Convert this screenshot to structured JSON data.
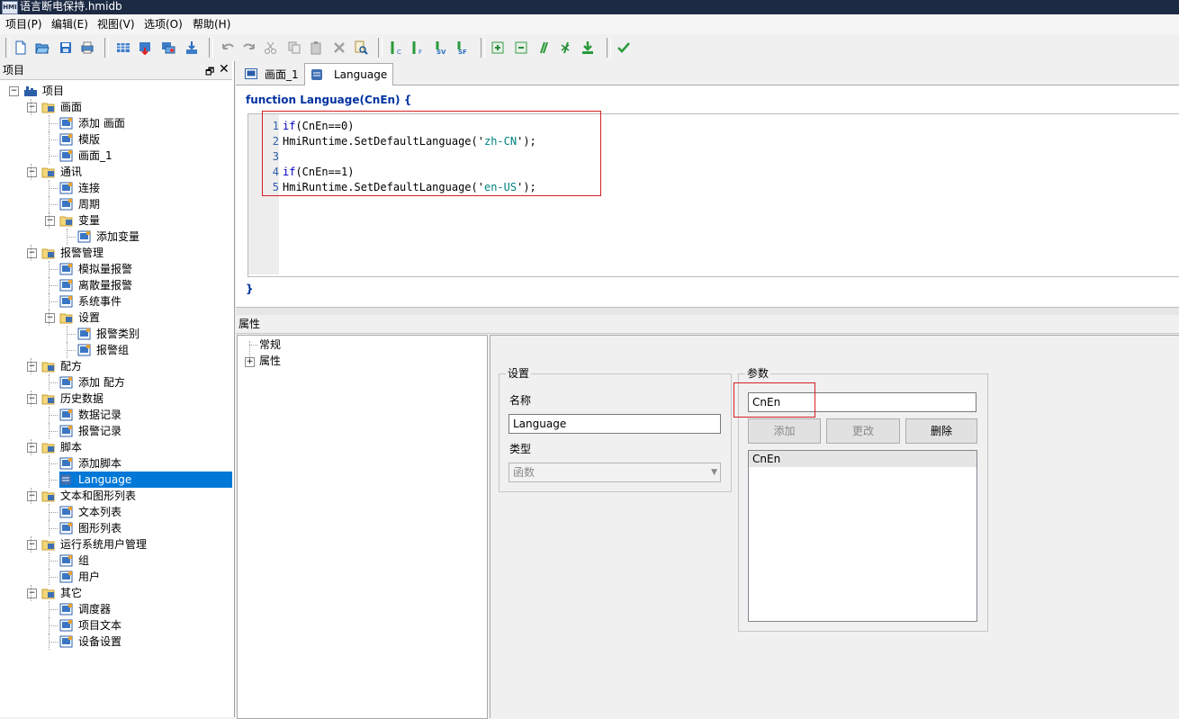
{
  "window": {
    "app_icon": "HMI",
    "title": "语言断电保持.hmidb"
  },
  "menu": [
    "项目(P)",
    "编辑(E)",
    "视图(V)",
    "选项(O)",
    "帮助(H)"
  ],
  "toolbar_icons": [
    "new-file-icon",
    "open-folder-icon",
    "save-icon",
    "print-icon",
    "grid-icon",
    "download-icon",
    "transfer-icon",
    "export-icon",
    "undo-icon",
    "redo-icon",
    "cut-icon",
    "copy-icon",
    "paste-icon",
    "delete-icon",
    "find-icon",
    "compile-c-icon",
    "compile-f-icon",
    "sv-icon",
    "sf-icon",
    "indent-icon",
    "outdent-icon",
    "comment-icon",
    "uncomment-icon",
    "insert-icon",
    "check-icon"
  ],
  "project_panel": {
    "title": "项目",
    "pin": "🗗",
    "close": "✕",
    "tree": [
      {
        "label": "项目",
        "level": 0,
        "icon": "project-icon"
      },
      {
        "label": "画面",
        "level": 1,
        "icon": "screens-folder-icon"
      },
      {
        "label": "添加 画面",
        "level": 2,
        "icon": "add-screen-icon"
      },
      {
        "label": "模版",
        "level": 2,
        "icon": "template-icon"
      },
      {
        "label": "画面_1",
        "level": 2,
        "icon": "screen-icon"
      },
      {
        "label": "通讯",
        "level": 1,
        "icon": "comm-folder-icon"
      },
      {
        "label": "连接",
        "level": 2,
        "icon": "connection-icon"
      },
      {
        "label": "周期",
        "level": 2,
        "icon": "cycle-icon"
      },
      {
        "label": "变量",
        "level": 2,
        "icon": "variables-folder-icon"
      },
      {
        "label": "添加变量",
        "level": 3,
        "icon": "add-variable-icon"
      },
      {
        "label": "报警管理",
        "level": 1,
        "icon": "alarm-folder-icon"
      },
      {
        "label": "模拟量报警",
        "level": 2,
        "icon": "analog-alarm-icon"
      },
      {
        "label": "离散量报警",
        "level": 2,
        "icon": "discrete-alarm-icon"
      },
      {
        "label": "系统事件",
        "level": 2,
        "icon": "system-event-icon"
      },
      {
        "label": "设置",
        "level": 2,
        "icon": "settings-folder-icon"
      },
      {
        "label": "报警类别",
        "level": 3,
        "icon": "alarm-class-icon"
      },
      {
        "label": "报警组",
        "level": 3,
        "icon": "alarm-group-icon"
      },
      {
        "label": "配方",
        "level": 1,
        "icon": "recipe-folder-icon"
      },
      {
        "label": "添加 配方",
        "level": 2,
        "icon": "add-recipe-icon"
      },
      {
        "label": "历史数据",
        "level": 1,
        "icon": "history-folder-icon"
      },
      {
        "label": "数据记录",
        "level": 2,
        "icon": "data-log-icon"
      },
      {
        "label": "报警记录",
        "level": 2,
        "icon": "alarm-log-icon"
      },
      {
        "label": "脚本",
        "level": 1,
        "icon": "scripts-folder-icon"
      },
      {
        "label": "添加脚本",
        "level": 2,
        "icon": "add-script-icon"
      },
      {
        "label": "Language",
        "level": 2,
        "icon": "script-icon",
        "selected": true
      },
      {
        "label": "文本和图形列表",
        "level": 1,
        "icon": "lists-folder-icon"
      },
      {
        "label": "文本列表",
        "level": 2,
        "icon": "text-list-icon"
      },
      {
        "label": "图形列表",
        "level": 2,
        "icon": "graphic-list-icon"
      },
      {
        "label": "运行系统用户管理",
        "level": 1,
        "icon": "user-admin-folder-icon"
      },
      {
        "label": "组",
        "level": 2,
        "icon": "group-icon"
      },
      {
        "label": "用户",
        "level": 2,
        "icon": "user-icon"
      },
      {
        "label": "其它",
        "level": 1,
        "icon": "other-folder-icon"
      },
      {
        "label": "调度器",
        "level": 2,
        "icon": "scheduler-icon"
      },
      {
        "label": "项目文本",
        "level": 2,
        "icon": "project-text-icon"
      },
      {
        "label": "设备设置",
        "level": 2,
        "icon": "device-settings-icon"
      }
    ]
  },
  "tabs": [
    {
      "label": "画面_1",
      "icon": "screen-icon",
      "active": false
    },
    {
      "label": "Language",
      "icon": "script-icon",
      "active": true
    }
  ],
  "editor": {
    "function_signature": "function Language(CnEn) {",
    "closing_brace": "}",
    "lines": [
      {
        "num": "1",
        "code": "if(CnEn==0)"
      },
      {
        "num": "2",
        "code": "HmiRuntime.SetDefaultLanguage('zh-CN');"
      },
      {
        "num": "3",
        "code": ""
      },
      {
        "num": "4",
        "code": "if(CnEn==1)"
      },
      {
        "num": "5",
        "code": "HmiRuntime.SetDefaultLanguage('en-US');"
      }
    ]
  },
  "properties": {
    "title": "属性",
    "tree": [
      {
        "label": "常规",
        "expandable": false
      },
      {
        "label": "属性",
        "expandable": true
      }
    ],
    "settings": {
      "group_label": "设置",
      "name_label": "名称",
      "name_value": "Language",
      "type_label": "类型",
      "type_value": "函数"
    },
    "params": {
      "group_label": "参数",
      "input_value": "CnEn",
      "add_button": "添加",
      "change_button": "更改",
      "delete_button": "删除",
      "list": [
        "CnEn"
      ]
    }
  }
}
